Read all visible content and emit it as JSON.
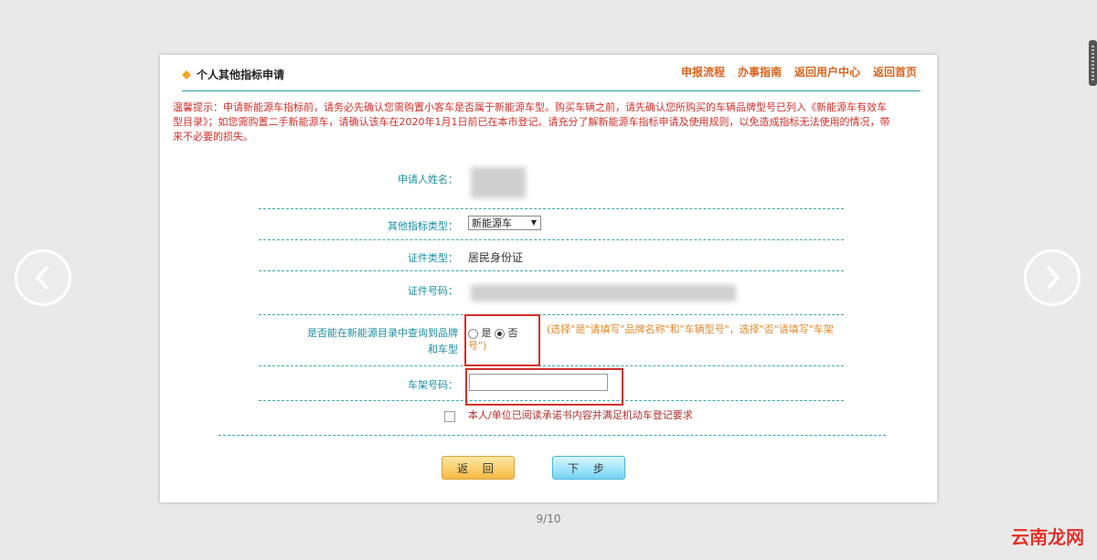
{
  "header": {
    "title": "个人其他指标申请",
    "nav": [
      "申报流程",
      "办事指南",
      "返回用户中心",
      "返回首页"
    ]
  },
  "notice": "温馨提示：申请新能源车指标前，请务必先确认您需购置小客车是否属于新能源车型。购买车辆之前，请先确认您所购买的车辆品牌型号已列入《新能源车有效车型目录》；如您需购置二手新能源车，请确认该车在2020年1月1日前已在本市登记。请充分了解新能源车指标申请及使用规则，以免造成指标无法使用的情况，带来不必要的损失。",
  "form": {
    "applicant_label": "申请人姓名：",
    "type_label": "其他指标类型：",
    "type_value": "新能源车",
    "id_type_label": "证件类型：",
    "id_type_value": "居民身份证",
    "id_no_label": "证件号码：",
    "query_label": "是否能在新能源目录中查询到品牌和车型",
    "radio_yes": "是",
    "radio_no": "否",
    "query_selected": "否",
    "query_hint": "(选择\"是\"请填写\"品牌名称\"和\"车辆型号\"，选择\"否\"请填写\"车架号\")",
    "vin_label": "车架号码：",
    "vin_value": "",
    "agree_text": "本人/单位已阅读承诺书内容并满足机动车登记要求"
  },
  "buttons": {
    "back": "返 回",
    "next": "下 步"
  },
  "pager": "9/10",
  "watermark": "云南龙网",
  "colors": {
    "accent": "#2aa2a6",
    "nav": "#d9641e",
    "notice": "#d0302a",
    "highlight": "#d3302b"
  }
}
